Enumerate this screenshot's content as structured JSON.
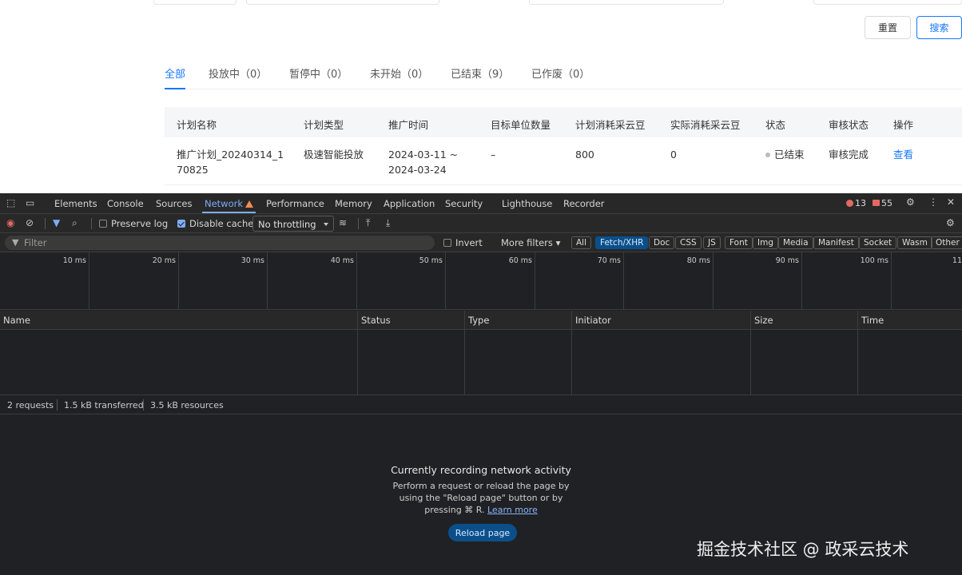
{
  "page": {
    "buttons": {
      "reset": "重置",
      "search": "搜索"
    },
    "tabs": [
      {
        "label": "全部",
        "active": true
      },
      {
        "label": "投放中（0）"
      },
      {
        "label": "暂停中（0）"
      },
      {
        "label": "未开始（0）"
      },
      {
        "label": "已结束（9）"
      },
      {
        "label": "已作废（0）"
      }
    ],
    "table": {
      "headers": [
        "计划名称",
        "计划类型",
        "推广时间",
        "目标单位数量",
        "计划消耗采云豆",
        "实际消耗采云豆",
        "状态",
        "审核状态",
        "操作"
      ],
      "rows": [
        {
          "name_line1": "推广计划_20240314_1",
          "name_line2": "70825",
          "type": "极速智能投放",
          "time_line1": "2024-03-11 ~",
          "time_line2": "2024-03-24",
          "target": "–",
          "plan_cost": "800",
          "actual_cost": "0",
          "status": "已结束",
          "audit": "审核完成",
          "action": "查看"
        }
      ]
    }
  },
  "devtools": {
    "tabs": [
      "Elements",
      "Console",
      "Sources",
      "Network",
      "Performance",
      "Memory",
      "Application",
      "Security",
      "Lighthouse",
      "Recorder"
    ],
    "active_tab": "Network",
    "errors": "13",
    "issues": "55",
    "toolbar": {
      "preserve_log": "Preserve log",
      "disable_cache": "Disable cache",
      "throttling": "No throttling"
    },
    "filter": {
      "placeholder": "Filter",
      "invert": "Invert",
      "more_filters": "More filters",
      "types": [
        "All",
        "Fetch/XHR",
        "Doc",
        "CSS",
        "JS",
        "Font",
        "Img",
        "Media",
        "Manifest",
        "Socket",
        "Wasm",
        "Other"
      ],
      "active_type": "Fetch/XHR"
    },
    "timeline_ticks": [
      "10 ms",
      "20 ms",
      "30 ms",
      "40 ms",
      "50 ms",
      "60 ms",
      "70 ms",
      "80 ms",
      "90 ms",
      "100 ms",
      "11"
    ],
    "columns": [
      "Name",
      "Status",
      "Type",
      "Initiator",
      "Size",
      "Time"
    ],
    "summary": {
      "requests": "2 requests",
      "transferred": "1.5 kB transferred",
      "resources": "3.5 kB resources"
    },
    "empty_state": {
      "title": "Currently recording network activity",
      "line1": "Perform a request or reload the page by",
      "line2": "using the \"Reload page\" button or by",
      "line3_prefix": "pressing ⌘ R.",
      "learn_more": "Learn more",
      "reload_button": "Reload page"
    }
  },
  "watermark": "掘金技术社区 @ 政采云技术",
  "colors": {
    "accent": "#1677ff",
    "devtools_bg": "#202124",
    "devtools_active": "#7cacf8",
    "error": "#e46962"
  }
}
